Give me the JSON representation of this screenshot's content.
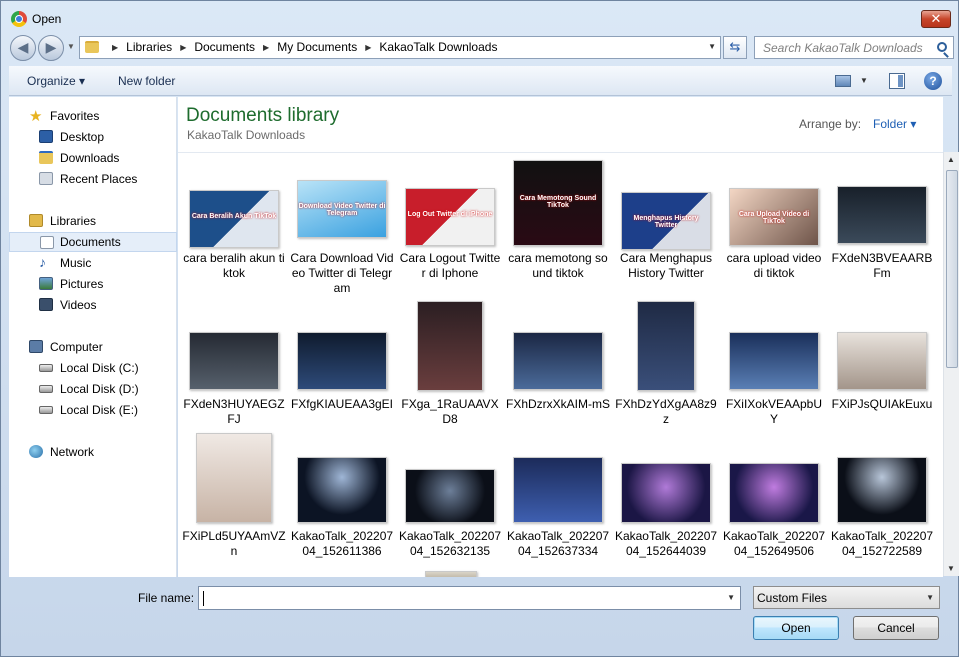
{
  "window": {
    "title": "Open",
    "close_symbol": "✕"
  },
  "address": {
    "crumbs": [
      "Libraries",
      "Documents",
      "My Documents",
      "KakaoTalk Downloads"
    ],
    "search_placeholder": "Search KakaoTalk Downloads"
  },
  "toolbar": {
    "organize": "Organize ▾",
    "new_folder": "New folder",
    "help": "?"
  },
  "sidebar": {
    "favorites_header": "Favorites",
    "favorites": [
      "Desktop",
      "Downloads",
      "Recent Places"
    ],
    "libraries_header": "Libraries",
    "libraries": [
      "Documents",
      "Music",
      "Pictures",
      "Videos"
    ],
    "computer_header": "Computer",
    "drives": [
      "Local Disk (C:)",
      "Local Disk (D:)",
      "Local Disk (E:)"
    ],
    "network_header": "Network",
    "selected": "Documents"
  },
  "content": {
    "library_title": "Documents library",
    "library_subtitle": "KakaoTalk Downloads",
    "arrange_label": "Arrange by:",
    "arrange_value": "Folder ▾"
  },
  "files": [
    {
      "name": "cara beralih akun tiktok",
      "thumb_text": "Cara Beralih Akun TikTok"
    },
    {
      "name": "Cara Download Video Twitter di Telegram",
      "thumb_text": "Download Video Twitter di Telegram"
    },
    {
      "name": "Cara Logout Twitter di Iphone",
      "thumb_text": "Log Out Twitter di iPhone"
    },
    {
      "name": "cara memotong sound tiktok",
      "thumb_text": "Cara Memotong Sound TikTok"
    },
    {
      "name": "Cara Menghapus History Twitter",
      "thumb_text": "Menghapus History Twitter"
    },
    {
      "name": "cara upload video di tiktok",
      "thumb_text": "Cara Upload Video di TikTok"
    },
    {
      "name": "FXdeN3BVEAARBFm",
      "thumb_text": ""
    },
    {
      "name": "FXdeN3HUYAEGZFJ",
      "thumb_text": ""
    },
    {
      "name": "FXfgKIAUEAA3gEI",
      "thumb_text": ""
    },
    {
      "name": "FXga_1RaUAAVXD8",
      "thumb_text": ""
    },
    {
      "name": "FXhDzrxXkAIM-mS",
      "thumb_text": ""
    },
    {
      "name": "FXhDzYdXgAA8z9z",
      "thumb_text": ""
    },
    {
      "name": "FXiIXokVEAApbUY",
      "thumb_text": ""
    },
    {
      "name": "FXiPJsQUIAkEuxu",
      "thumb_text": ""
    },
    {
      "name": "FXiPLd5UYAAmVZn",
      "thumb_text": ""
    },
    {
      "name": "KakaoTalk_20220704_152611386",
      "thumb_text": ""
    },
    {
      "name": "KakaoTalk_20220704_152632135",
      "thumb_text": ""
    },
    {
      "name": "KakaoTalk_20220704_152637334",
      "thumb_text": ""
    },
    {
      "name": "KakaoTalk_20220704_152644039",
      "thumb_text": ""
    },
    {
      "name": "KakaoTalk_20220704_152649506",
      "thumb_text": ""
    },
    {
      "name": "KakaoTalk_20220704_152722589",
      "thumb_text": ""
    }
  ],
  "bottom": {
    "file_name_label": "File name:",
    "file_name_value": "",
    "filter_value": "Custom Files",
    "open_label": "Open",
    "cancel_label": "Cancel"
  }
}
